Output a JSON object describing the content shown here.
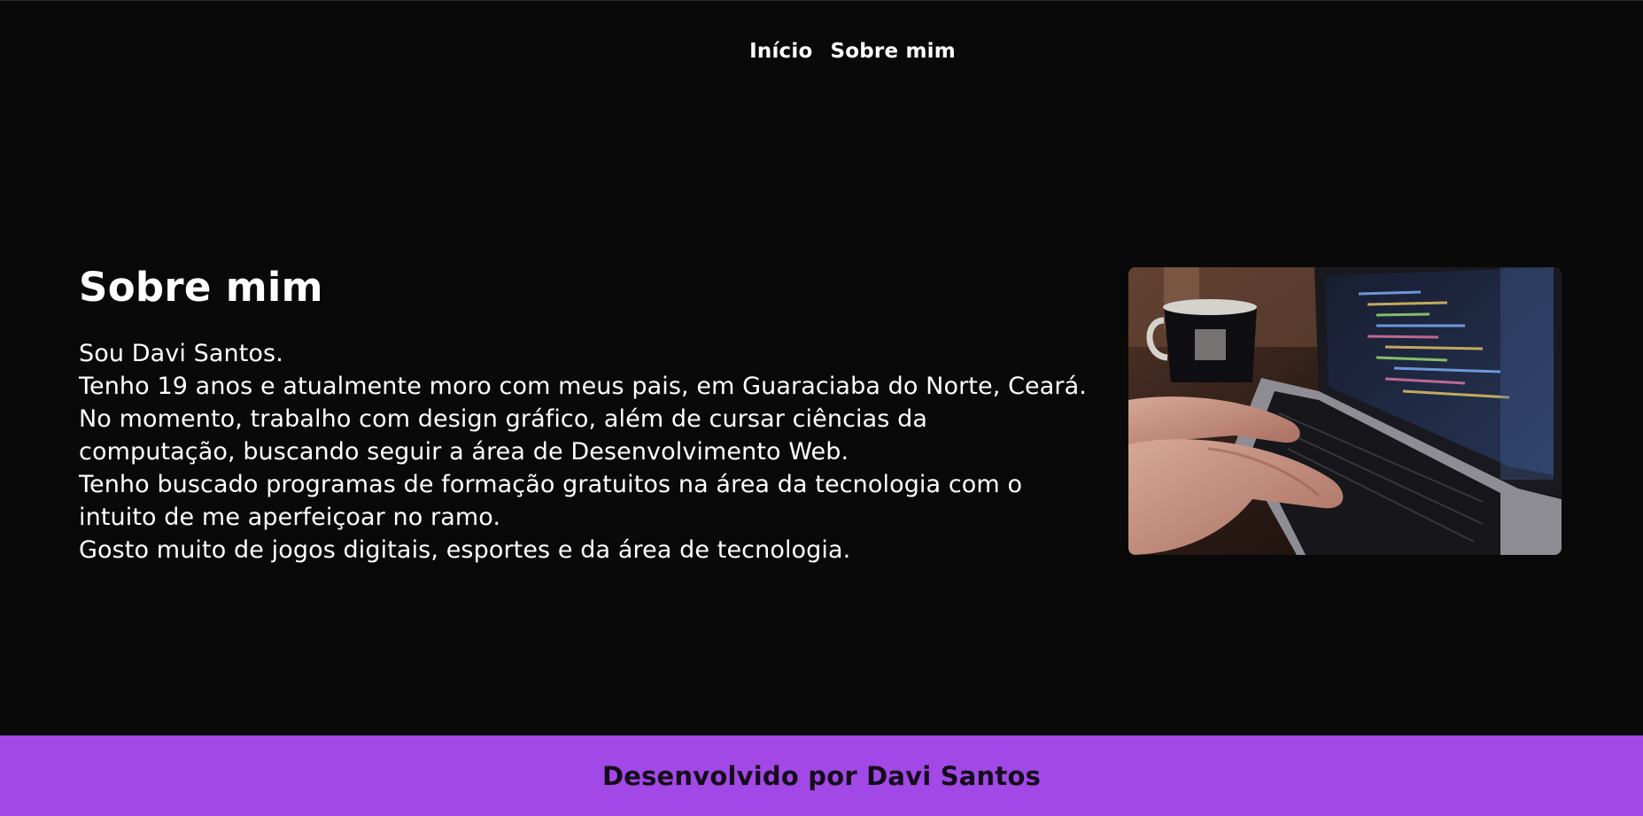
{
  "nav": {
    "items": [
      {
        "label": "Início"
      },
      {
        "label": "Sobre mim"
      }
    ]
  },
  "about": {
    "title": "Sobre mim",
    "paragraphs": [
      "Sou Davi Santos.",
      "Tenho 19 anos e atualmente moro com meus pais, em Guaraciaba do Norte, Ceará. No momento, trabalho com design gráfico, além de cursar ciências da computação, buscando seguir a área de Desenvolvimento Web.",
      "Tenho buscado programas de formação gratuitos na área da tecnologia com o intuito de me aperfeiçoar no ramo.",
      "Gosto muito de jogos digitais, esportes e da área de tecnologia."
    ]
  },
  "footer": {
    "text": "Desenvolvido por Davi Santos"
  },
  "colors": {
    "background": "#0a0909",
    "footer": "#a248e6",
    "text": "#ffffff"
  }
}
